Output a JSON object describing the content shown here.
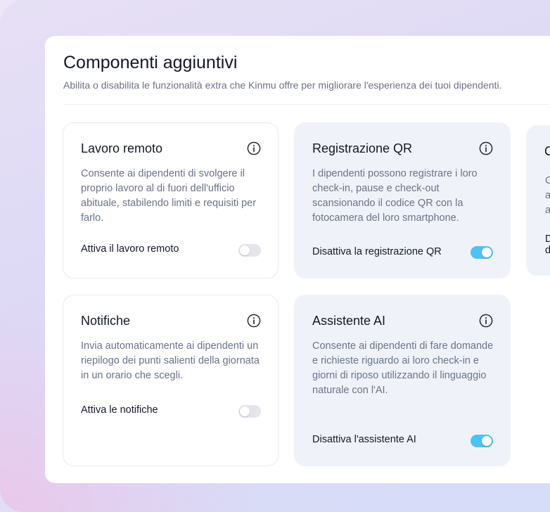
{
  "header": {
    "title": "Componenti aggiuntivi",
    "subtitle": "Abilita o disabilita le funzionalità extra che Kinmu offre per migliorare l'esperienza dei tuoi dipendenti."
  },
  "cards": [
    {
      "title": "Lavoro remoto",
      "description": "Consente ai dipendenti di svolgere il proprio lavoro al di fuori dell'ufficio abituale, stabilendo limiti e requisiti per farlo.",
      "action_label": "Attiva il lavoro remoto",
      "enabled": false
    },
    {
      "title": "Registrazione QR",
      "description": "I dipendenti possono registrare i loro check-in, pause e check-out scansionando il codice QR con la fotocamera del loro smartphone.",
      "action_label": "Disattiva la registrazione QR",
      "enabled": true
    },
    {
      "title": "Notifiche",
      "description": "Invia automaticamente ai dipendenti un riepilogo dei punti salienti della giornata in un orario che scegli.",
      "action_label": "Attiva le notifiche",
      "enabled": false
    },
    {
      "title": "Assistente AI",
      "description": "Consente ai dipendenti di fare domande e richieste riguardo ai loro check-in e giorni di riposo utilizzando il linguaggio naturale con l'AI.",
      "action_label": "Disattiva l'assistente AI",
      "enabled": true
    }
  ],
  "partial_card": {
    "title": "C",
    "desc_lines": [
      "C",
      "a",
      "a"
    ],
    "action_lines": [
      "D",
      "d"
    ]
  },
  "colors": {
    "toggle_on": "#4cc3f2",
    "toggle_off": "#e3e5ea",
    "active_card_bg": "#eff3f9"
  },
  "icons": {
    "info": "info-circle-icon"
  }
}
